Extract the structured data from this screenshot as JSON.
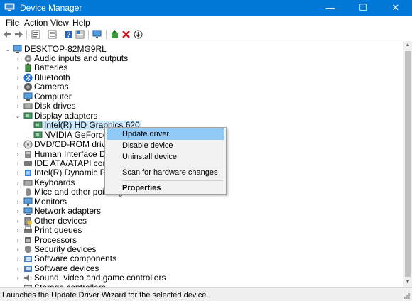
{
  "window": {
    "title": "Device Manager",
    "controls": {
      "minimize": "—",
      "maximize": "☐",
      "close": "✕"
    }
  },
  "menu": [
    "File",
    "Action",
    "View",
    "Help"
  ],
  "toolbar": [
    "back-arrow-icon",
    "forward-arrow-icon",
    "properties-icon",
    "details-icon",
    "help-icon",
    "view-icon",
    "monitor-scan-icon",
    "update-driver-icon",
    "uninstall-x-icon",
    "download-icon"
  ],
  "tree": {
    "root": "DESKTOP-82MG9RL",
    "items": [
      {
        "label": "Audio inputs and outputs",
        "expander": "›"
      },
      {
        "label": "Batteries",
        "expander": "›"
      },
      {
        "label": "Bluetooth",
        "expander": "›"
      },
      {
        "label": "Cameras",
        "expander": "›"
      },
      {
        "label": "Computer",
        "expander": "›"
      },
      {
        "label": "Disk drives",
        "expander": "›"
      },
      {
        "label": "Display adapters",
        "expander": "⌄"
      },
      {
        "label": "Intel(R) HD Graphics 620"
      },
      {
        "label": "NVIDIA GeForce 940M"
      },
      {
        "label": "DVD/CD-ROM drives",
        "expander": "›"
      },
      {
        "label": "Human Interface Devices",
        "expander": "›"
      },
      {
        "label": "IDE ATA/ATAPI controllers",
        "expander": "›"
      },
      {
        "label": "Intel(R) Dynamic Platform and Thermal Framework",
        "expander": "›"
      },
      {
        "label": "Keyboards",
        "expander": "›"
      },
      {
        "label": "Mice and other pointing devices",
        "expander": "›"
      },
      {
        "label": "Monitors",
        "expander": "›"
      },
      {
        "label": "Network adapters",
        "expander": "›"
      },
      {
        "label": "Other devices",
        "expander": "›"
      },
      {
        "label": "Print queues",
        "expander": "›"
      },
      {
        "label": "Processors",
        "expander": "›"
      },
      {
        "label": "Security devices",
        "expander": "›"
      },
      {
        "label": "Software components",
        "expander": "›"
      },
      {
        "label": "Software devices",
        "expander": "›"
      },
      {
        "label": "Sound, video and game controllers",
        "expander": "›"
      },
      {
        "label": "Storage controllers",
        "expander": "›"
      }
    ]
  },
  "context_menu": {
    "update": "Update driver",
    "disable": "Disable device",
    "uninstall": "Uninstall device",
    "scan": "Scan for hardware changes",
    "properties": "Properties"
  },
  "status": "Launches the Update Driver Wizard for the selected device.",
  "colors": {
    "titlebar": "#0078d7",
    "selection": "#cce8ff",
    "menu_highlight": "#91c9f7"
  }
}
